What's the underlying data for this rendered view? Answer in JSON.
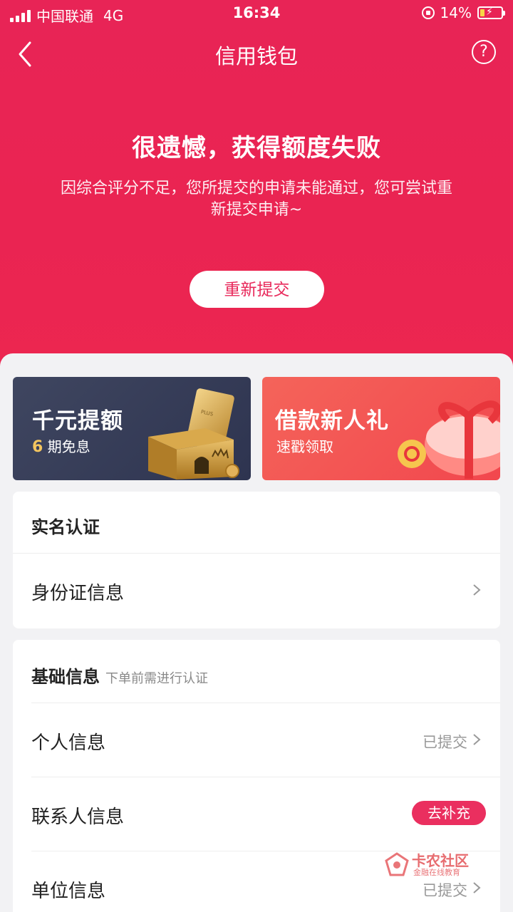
{
  "status_bar": {
    "carrier": "中国联通",
    "network": "4G",
    "time": "16:34",
    "battery": "14%"
  },
  "nav": {
    "title": "信用钱包",
    "help": "?"
  },
  "result": {
    "title": "很遗憾，获得额度失败",
    "description": "因综合评分不足，您所提交的申请未能通过，您可尝试重新提交申请~",
    "resubmit_label": "重新提交"
  },
  "banners": [
    {
      "title": "千元提额",
      "subtitle_num": "6",
      "subtitle": " 期免息",
      "card_text": "PLUS"
    },
    {
      "title": "借款新人礼",
      "subtitle": "速戳领取"
    }
  ],
  "realname": {
    "header": "实名认证",
    "rows": [
      {
        "label": "身份证信息"
      }
    ]
  },
  "basic": {
    "header": "基础信息",
    "subheader": "下单前需进行认证",
    "rows": [
      {
        "label": "个人信息",
        "status": "已提交"
      },
      {
        "label": "联系人信息",
        "action": "去补充"
      },
      {
        "label": "单位信息",
        "status": "已提交"
      }
    ]
  },
  "watermark": {
    "title": "卡农社区",
    "subtitle": "金融在线教育"
  },
  "colors": {
    "primary": "#e8245a",
    "banner_dark": "#353b57",
    "banner_red": "#f3534f",
    "pill": "#ea2f5f"
  }
}
